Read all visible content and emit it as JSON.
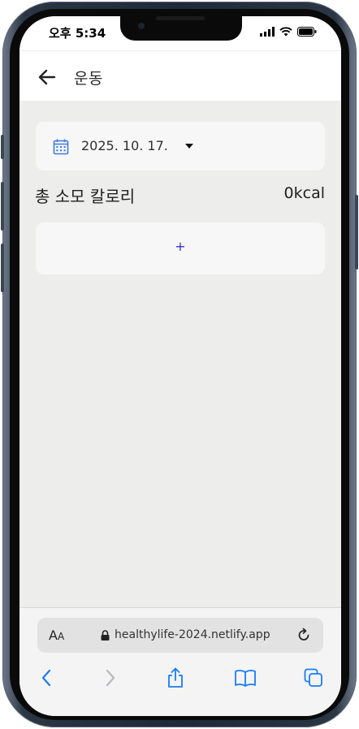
{
  "status_bar": {
    "time": "오후 5:34"
  },
  "header": {
    "title": "운동"
  },
  "date_picker": {
    "value": "2025. 10. 17."
  },
  "calories": {
    "label": "총 소모 칼로리",
    "value": "0kcal"
  },
  "add_button": {
    "label": "+"
  },
  "browser": {
    "text_size": {
      "big": "A",
      "small": "A"
    },
    "url": "healthylife-2024.netlify.app"
  },
  "colors": {
    "accent": "#3b2fc9",
    "link_blue": "#1a7cf3",
    "content_bg": "#ededec"
  }
}
